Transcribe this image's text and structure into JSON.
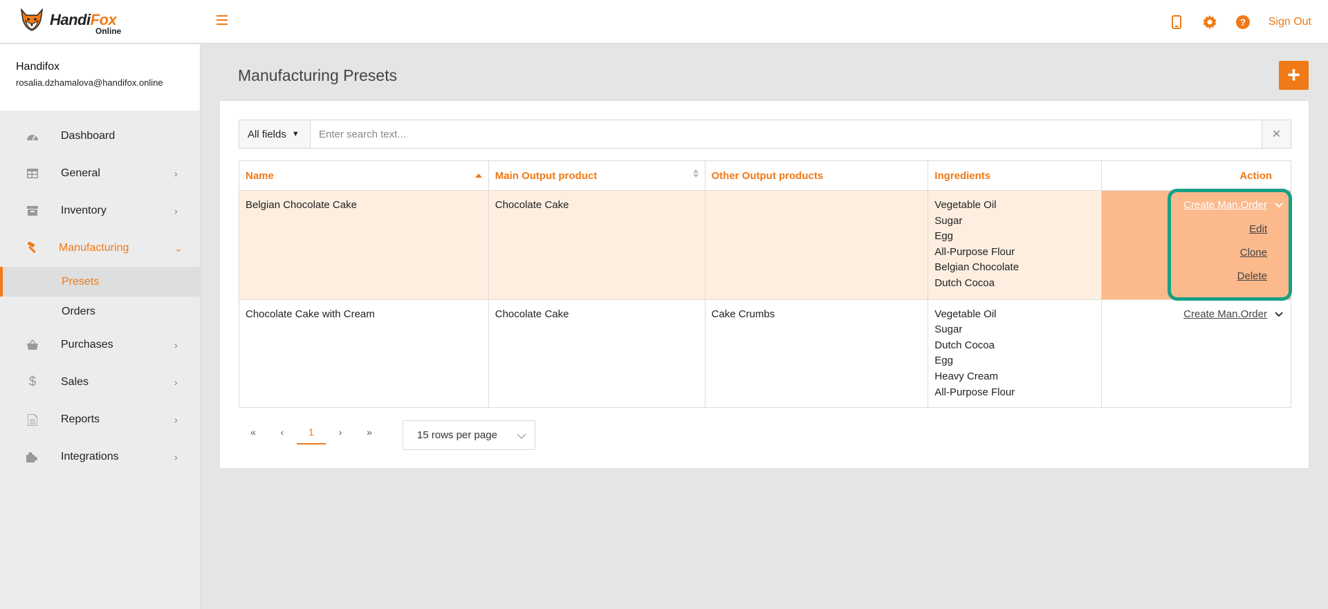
{
  "header": {
    "brand_main": "Handi",
    "brand_accent": "Fox",
    "brand_sub": "Online",
    "signout_label": "Sign Out",
    "icons": [
      "mobile-icon",
      "gear-icon",
      "help-icon"
    ]
  },
  "user": {
    "name": "Handifox",
    "email": "rosalia.dzhamalova@handifox.online"
  },
  "sidebar": {
    "items": [
      {
        "label": "Dashboard",
        "icon": "dashboard-icon"
      },
      {
        "label": "General",
        "icon": "table-icon"
      },
      {
        "label": "Inventory",
        "icon": "archive-icon"
      },
      {
        "label": "Manufacturing",
        "icon": "hammer-icon"
      },
      {
        "label": "Purchases",
        "icon": "basket-icon"
      },
      {
        "label": "Sales",
        "icon": "dollar-icon"
      },
      {
        "label": "Reports",
        "icon": "document-icon"
      },
      {
        "label": "Integrations",
        "icon": "puzzle-icon"
      }
    ],
    "subitems": [
      {
        "label": "Presets"
      },
      {
        "label": "Orders"
      }
    ]
  },
  "page": {
    "title": "Manufacturing Presets",
    "add_label": "+"
  },
  "search": {
    "field_label": "All fields",
    "placeholder": "Enter search text..."
  },
  "table": {
    "headers": {
      "name": "Name",
      "main": "Main Output product",
      "other": "Other Output products",
      "ingredients": "Ingredients",
      "action": "Action"
    },
    "rows": [
      {
        "name": "Belgian Chocolate Cake",
        "main": "Chocolate Cake",
        "other": "",
        "ingredients": [
          "Vegetable Oil",
          "Sugar",
          "Egg",
          "All-Purpose Flour",
          "Belgian Chocolate",
          "Dutch Cocoa"
        ],
        "action": "Create Man.Order",
        "menu": [
          "Edit",
          "Clone",
          "Delete"
        ]
      },
      {
        "name": "Chocolate Cake with Cream",
        "main": "Chocolate Cake",
        "other": "Cake Crumbs",
        "ingredients": [
          "Vegetable Oil",
          "Sugar",
          "Dutch Cocoa",
          "Egg",
          "Heavy Cream",
          "All-Purpose Flour"
        ],
        "action": "Create Man.Order"
      }
    ]
  },
  "pagination": {
    "first": "«",
    "prev": "‹",
    "current": "1",
    "next": "›",
    "last": "»",
    "rows_per_page": "15 rows per page"
  },
  "colors": {
    "accent": "#f07a17",
    "highlight_row": "#fdeee0",
    "action_cell": "#fbb98c",
    "callout": "#16a085"
  }
}
